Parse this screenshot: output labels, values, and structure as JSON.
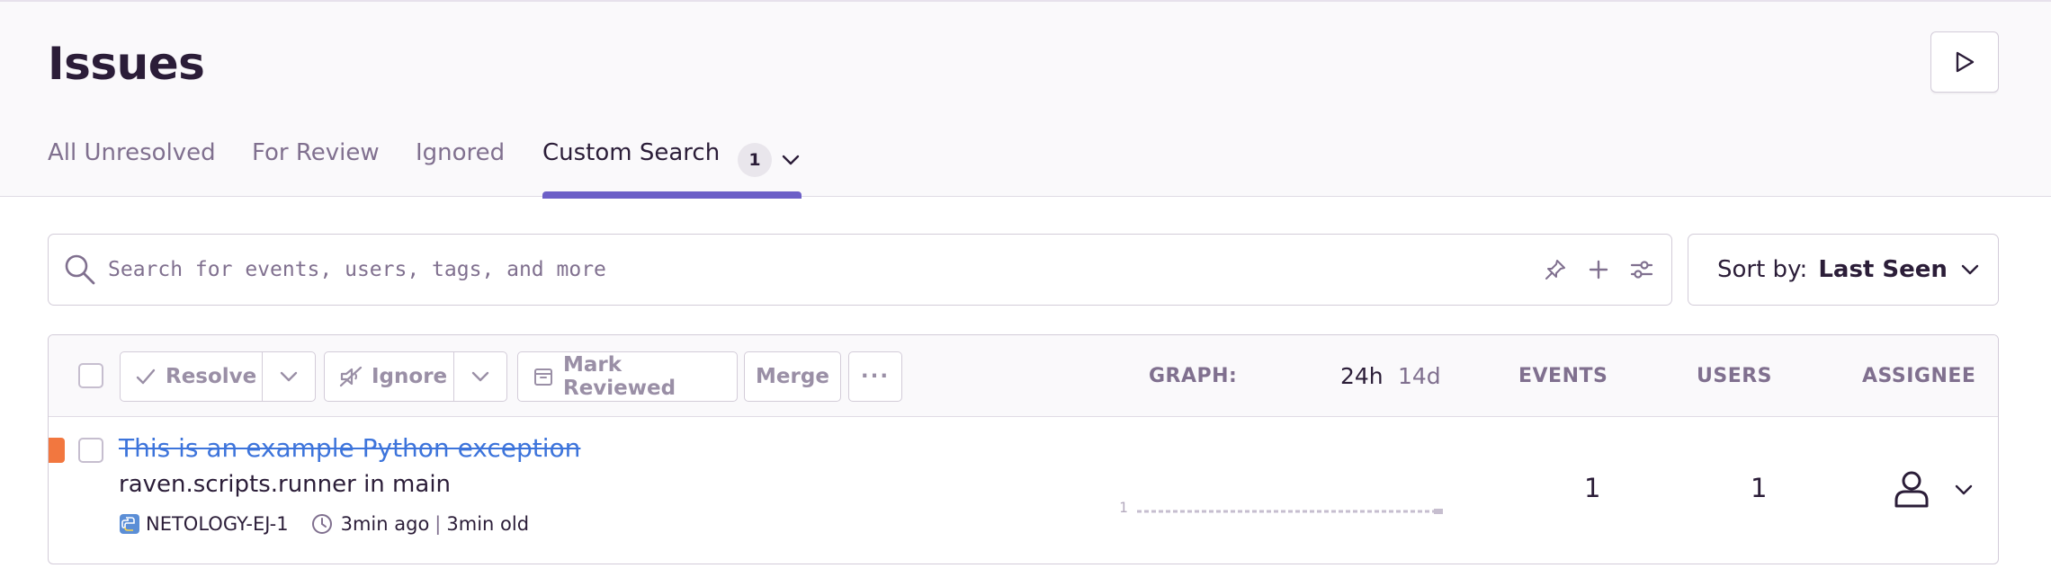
{
  "header": {
    "title": "Issues",
    "tabs": [
      {
        "label": "All Unresolved",
        "active": false
      },
      {
        "label": "For Review",
        "active": false
      },
      {
        "label": "Ignored",
        "active": false
      },
      {
        "label": "Custom Search",
        "active": true,
        "badge": "1"
      }
    ],
    "accent_color": "#6c5fc7"
  },
  "search": {
    "placeholder": "Search for events, users, tags, and more",
    "value": "",
    "icons": [
      "pin-icon",
      "plus-icon",
      "sliders-icon"
    ]
  },
  "sort": {
    "label": "Sort by:",
    "value": "Last Seen"
  },
  "toolbar": {
    "resolve_label": "Resolve",
    "ignore_label": "Ignore",
    "mark_reviewed_label": "Mark Reviewed",
    "merge_label": "Merge",
    "more_label": "···",
    "graph_label": "GRAPH:",
    "period_24h": "24h",
    "period_14d": "14d",
    "events_label": "EVENTS",
    "users_label": "USERS",
    "assignee_label": "ASSIGNEE"
  },
  "issues": [
    {
      "title": "This is an example Python exception",
      "culprit": "raven.scripts.runner in main",
      "short_id": "NETOLOGY-EJ-1",
      "last_seen": "3min ago",
      "separator": "|",
      "age": "3min old",
      "graph_max_label": "1",
      "events": "1",
      "users": "1",
      "level_color": "#f2773f",
      "resolved": true
    }
  ]
}
